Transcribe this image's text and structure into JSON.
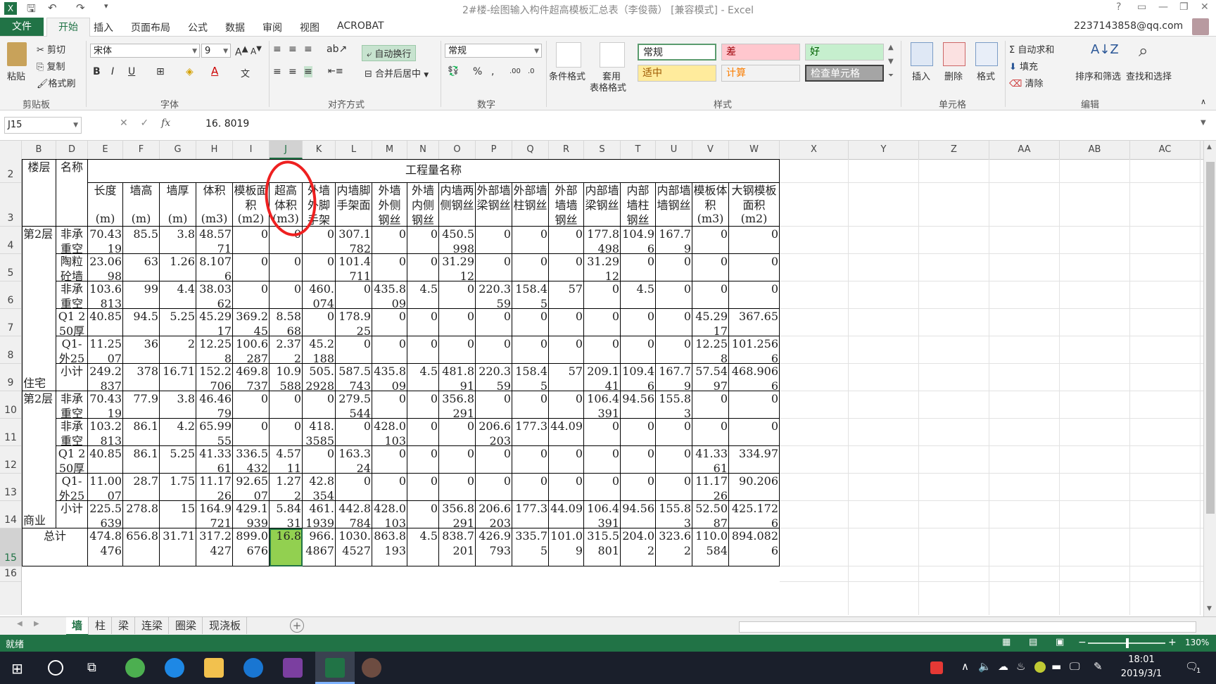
{
  "window": {
    "title": "2#楼-绘图输入构件超高模板汇总表（李俊薇） [兼容模式] - Excel",
    "account": "2237143858@qq.com"
  },
  "ribbon_tabs": [
    "文件",
    "开始",
    "插入",
    "页面布局",
    "公式",
    "数据",
    "审阅",
    "视图",
    "ACROBAT"
  ],
  "ribbon": {
    "clipboard": {
      "paste": "粘贴",
      "cut": "剪切",
      "copy": "复制",
      "format_painter": "格式刷",
      "label": "剪贴板"
    },
    "font": {
      "name": "宋体",
      "size": "9",
      "label": "字体"
    },
    "alignment": {
      "wrap": "自动换行",
      "merge": "合并后居中",
      "label": "对齐方式"
    },
    "number": {
      "format": "常规",
      "label": "数字"
    },
    "styles": {
      "conditional": "条件格式",
      "table_format_1": "套用",
      "table_format_2": "表格格式",
      "normal": "常规",
      "bad": "差",
      "good": "好",
      "neutral": "适中",
      "calculation": "计算",
      "check_cell": "检查单元格",
      "label": "样式",
      "bad_color": "#ffc7ce",
      "good_color": "#c6efce",
      "neutral_color": "#ffeb9c"
    },
    "cells": {
      "insert": "插入",
      "delete": "删除",
      "format": "格式",
      "label": "单元格"
    },
    "editing": {
      "autosum": "自动求和",
      "fill": "填充",
      "clear": "清除",
      "sort": "排序和筛选",
      "find": "查找和选择",
      "label": "编辑"
    }
  },
  "formula_bar": {
    "name_box": "J15",
    "value": "16. 8019"
  },
  "columns": [
    "B",
    "D",
    "E",
    "F",
    "G",
    "H",
    "I",
    "J",
    "K",
    "L",
    "M",
    "N",
    "O",
    "P",
    "Q",
    "R",
    "S",
    "T",
    "U",
    "V",
    "W",
    "X",
    "Y",
    "Z",
    "AA",
    "AB",
    "AC"
  ],
  "rows": [
    "2",
    "3",
    "4",
    "5",
    "6",
    "7",
    "8",
    "9",
    "10",
    "11",
    "12",
    "13",
    "14",
    "15",
    "16"
  ],
  "sheet": {
    "hdr_floor": "楼层",
    "hdr_name": "名称",
    "hdr_group": "工程量名称",
    "col_headers": [
      [
        "长度",
        "(m)"
      ],
      [
        "墙高",
        "(m)"
      ],
      [
        "墙厚",
        "(m)"
      ],
      [
        "体积",
        "(m3)"
      ],
      [
        "模板面积",
        "(m2)"
      ],
      [
        "超高体积",
        "(m3)"
      ],
      [
        "外墙外脚手架",
        ""
      ],
      [
        "内墙脚手架面",
        ""
      ],
      [
        "外墙外侧钢丝",
        ""
      ],
      [
        "外墙内侧钢丝",
        ""
      ],
      [
        "内墙两侧钢丝",
        ""
      ],
      [
        "外部墙梁钢丝",
        ""
      ],
      [
        "外部墙柱钢丝",
        ""
      ],
      [
        "外部墙墙钢丝",
        ""
      ],
      [
        "内部墙梁钢丝",
        ""
      ],
      [
        "内部墙柱钢丝",
        ""
      ],
      [
        "内部墙墙钢丝",
        ""
      ],
      [
        "模板体积",
        "(m3)"
      ],
      [
        "大钢模板面积",
        "(m2)"
      ]
    ],
    "floor_labels": [
      "第2层",
      "住宅",
      "第2层",
      "商业"
    ],
    "total_label": "总计",
    "data_rows": [
      {
        "name": "非承重空",
        "vals": [
          "70.4319",
          "85.5",
          "3.8",
          "48.5771",
          "0",
          "0",
          "0",
          "307.1782",
          "0",
          "0",
          "450.5998",
          "0",
          "0",
          "0",
          "177.8498",
          "104.96",
          "167.79",
          "0",
          "0"
        ]
      },
      {
        "name": "陶粒砼墙",
        "vals": [
          "23.0698",
          "63",
          "1.26",
          "8.1076",
          "0",
          "0",
          "0",
          "101.4711",
          "0",
          "0",
          "31.2912",
          "0",
          "0",
          "0",
          "31.2912",
          "0",
          "0",
          "0",
          "0"
        ]
      },
      {
        "name": "非承重空",
        "vals": [
          "103.6813",
          "99",
          "4.4",
          "38.0362",
          "0",
          "0",
          "460.074",
          "0",
          "435.809",
          "4.5",
          "0",
          "220.359",
          "158.45",
          "57",
          "0",
          "4.5",
          "0",
          "0",
          "0"
        ]
      },
      {
        "name": "Q1 250厚",
        "vals": [
          "40.85",
          "94.5",
          "5.25",
          "45.2917",
          "369.245",
          "8.5868",
          "0",
          "178.925",
          "0",
          "0",
          "0",
          "0",
          "0",
          "0",
          "0",
          "0",
          "0",
          "45.2917",
          "367.65"
        ]
      },
      {
        "name": "Q1-外250厚",
        "vals": [
          "11.2507",
          "36",
          "2",
          "12.258",
          "100.6287",
          "2.372",
          "45.2188",
          "0",
          "0",
          "0",
          "0",
          "0",
          "0",
          "0",
          "0",
          "0",
          "0",
          "12.258",
          "101.2566"
        ]
      },
      {
        "name": "小计",
        "vals": [
          "249.2837",
          "378",
          "16.71",
          "152.2706",
          "469.8737",
          "10.9588",
          "505.2928",
          "587.5743",
          "435.809",
          "4.5",
          "481.891",
          "220.359",
          "158.45",
          "57",
          "209.141",
          "109.46",
          "167.79",
          "57.5497",
          "468.9066"
        ]
      },
      {
        "name": "非承重空",
        "vals": [
          "70.4319",
          "77.9",
          "3.8",
          "46.4679",
          "0",
          "0",
          "0",
          "279.5544",
          "0",
          "0",
          "356.8291",
          "0",
          "0",
          "0",
          "106.4391",
          "94.56",
          "155.83",
          "0",
          "0"
        ]
      },
      {
        "name": "非承重空",
        "vals": [
          "103.2813",
          "86.1",
          "4.2",
          "65.9955",
          "0",
          "0",
          "418.3585",
          "0",
          "428.0103",
          "0",
          "0",
          "206.6203",
          "177.3",
          "44.09",
          "0",
          "0",
          "0",
          "0",
          "0"
        ]
      },
      {
        "name": "Q1 250厚",
        "vals": [
          "40.85",
          "86.1",
          "5.25",
          "41.3361",
          "336.5432",
          "4.5711",
          "0",
          "163.324",
          "0",
          "0",
          "0",
          "0",
          "0",
          "0",
          "0",
          "0",
          "0",
          "41.3361",
          "334.97"
        ]
      },
      {
        "name": "Q1-外250厚",
        "vals": [
          "11.0007",
          "28.7",
          "1.75",
          "11.1726",
          "92.6507",
          "1.272",
          "42.8354",
          "0",
          "0",
          "0",
          "0",
          "0",
          "0",
          "0",
          "0",
          "0",
          "0",
          "11.1726",
          "90.206"
        ]
      },
      {
        "name": "小计",
        "vals": [
          "225.5639",
          "278.8",
          "15",
          "164.9721",
          "429.1939",
          "5.8431",
          "461.1939",
          "442.8784",
          "428.0103",
          "0",
          "356.8291",
          "206.6203",
          "177.3",
          "44.09",
          "106.4391",
          "94.56",
          "155.83",
          "52.5087",
          "425.1726"
        ]
      }
    ],
    "total_row": {
      "vals": [
        "474.8476",
        "656.8",
        "31.71",
        "317.2427",
        "899.0676",
        "16.8",
        "966.4867",
        "1030.4527",
        "863.8193",
        "4.5",
        "838.7201",
        "426.9793",
        "335.75",
        "101.09",
        "315.5801",
        "204.02",
        "323.62",
        "110.0584",
        "894.0826"
      ]
    }
  },
  "sheet_tabs": [
    "墙",
    "柱",
    "梁",
    "连梁",
    "圈梁",
    "现浇板"
  ],
  "active_sheet": "墙",
  "status": {
    "ready": "就绪",
    "zoom": "130%"
  },
  "taskbar": {
    "time": "18:01",
    "date": "2019/3/1",
    "notif": "1"
  },
  "colors": {
    "excel_green": "#217346",
    "selected_cell": "#92d050",
    "annotation_circle": "#ee2020"
  }
}
